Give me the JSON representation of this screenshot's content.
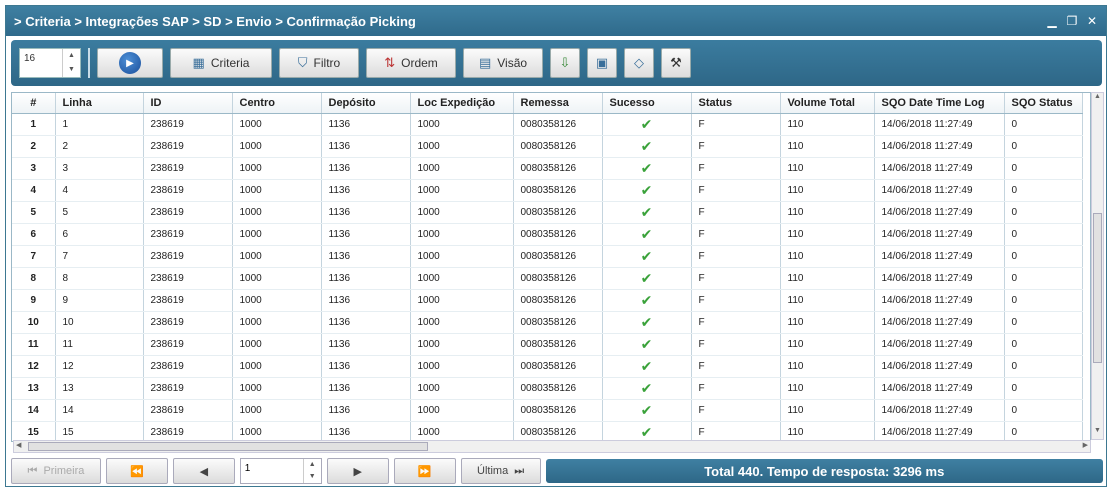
{
  "window": {
    "title": "> Criteria > Integrações SAP > SD > Envio > Confirmação Picking"
  },
  "toolbar": {
    "page_size": "16",
    "criteria_label": "Criteria",
    "filtro_label": "Filtro",
    "ordem_label": "Ordem",
    "visao_label": "Visão"
  },
  "table": {
    "columns": [
      "#",
      "Linha",
      "ID",
      "Centro",
      "Depósito",
      "Loc Expedição",
      "Remessa",
      "Sucesso",
      "Status",
      "Volume Total",
      "SQO Date Time Log",
      "SQO Status"
    ],
    "rows": [
      [
        "1",
        "1",
        "238619",
        "1000",
        "1136",
        "1000",
        "0080358126",
        "✔",
        "F",
        "110",
        "14/06/2018 11:27:49",
        "0"
      ],
      [
        "2",
        "2",
        "238619",
        "1000",
        "1136",
        "1000",
        "0080358126",
        "✔",
        "F",
        "110",
        "14/06/2018 11:27:49",
        "0"
      ],
      [
        "3",
        "3",
        "238619",
        "1000",
        "1136",
        "1000",
        "0080358126",
        "✔",
        "F",
        "110",
        "14/06/2018 11:27:49",
        "0"
      ],
      [
        "4",
        "4",
        "238619",
        "1000",
        "1136",
        "1000",
        "0080358126",
        "✔",
        "F",
        "110",
        "14/06/2018 11:27:49",
        "0"
      ],
      [
        "5",
        "5",
        "238619",
        "1000",
        "1136",
        "1000",
        "0080358126",
        "✔",
        "F",
        "110",
        "14/06/2018 11:27:49",
        "0"
      ],
      [
        "6",
        "6",
        "238619",
        "1000",
        "1136",
        "1000",
        "0080358126",
        "✔",
        "F",
        "110",
        "14/06/2018 11:27:49",
        "0"
      ],
      [
        "7",
        "7",
        "238619",
        "1000",
        "1136",
        "1000",
        "0080358126",
        "✔",
        "F",
        "110",
        "14/06/2018 11:27:49",
        "0"
      ],
      [
        "8",
        "8",
        "238619",
        "1000",
        "1136",
        "1000",
        "0080358126",
        "✔",
        "F",
        "110",
        "14/06/2018 11:27:49",
        "0"
      ],
      [
        "9",
        "9",
        "238619",
        "1000",
        "1136",
        "1000",
        "0080358126",
        "✔",
        "F",
        "110",
        "14/06/2018 11:27:49",
        "0"
      ],
      [
        "10",
        "10",
        "238619",
        "1000",
        "1136",
        "1000",
        "0080358126",
        "✔",
        "F",
        "110",
        "14/06/2018 11:27:49",
        "0"
      ],
      [
        "11",
        "11",
        "238619",
        "1000",
        "1136",
        "1000",
        "0080358126",
        "✔",
        "F",
        "110",
        "14/06/2018 11:27:49",
        "0"
      ],
      [
        "12",
        "12",
        "238619",
        "1000",
        "1136",
        "1000",
        "0080358126",
        "✔",
        "F",
        "110",
        "14/06/2018 11:27:49",
        "0"
      ],
      [
        "13",
        "13",
        "238619",
        "1000",
        "1136",
        "1000",
        "0080358126",
        "✔",
        "F",
        "110",
        "14/06/2018 11:27:49",
        "0"
      ],
      [
        "14",
        "14",
        "238619",
        "1000",
        "1136",
        "1000",
        "0080358126",
        "✔",
        "F",
        "110",
        "14/06/2018 11:27:49",
        "0"
      ],
      [
        "15",
        "15",
        "238619",
        "1000",
        "1136",
        "1000",
        "0080358126",
        "✔",
        "F",
        "110",
        "14/06/2018 11:27:49",
        "0"
      ]
    ]
  },
  "pager": {
    "first_label": "Primeira",
    "last_label": "Última",
    "page_value": "1"
  },
  "status": {
    "text": "Total 440. Tempo de resposta: 3296 ms"
  },
  "colors": {
    "header_bar": "#2f6a8b",
    "success_check": "#3aa23a"
  }
}
